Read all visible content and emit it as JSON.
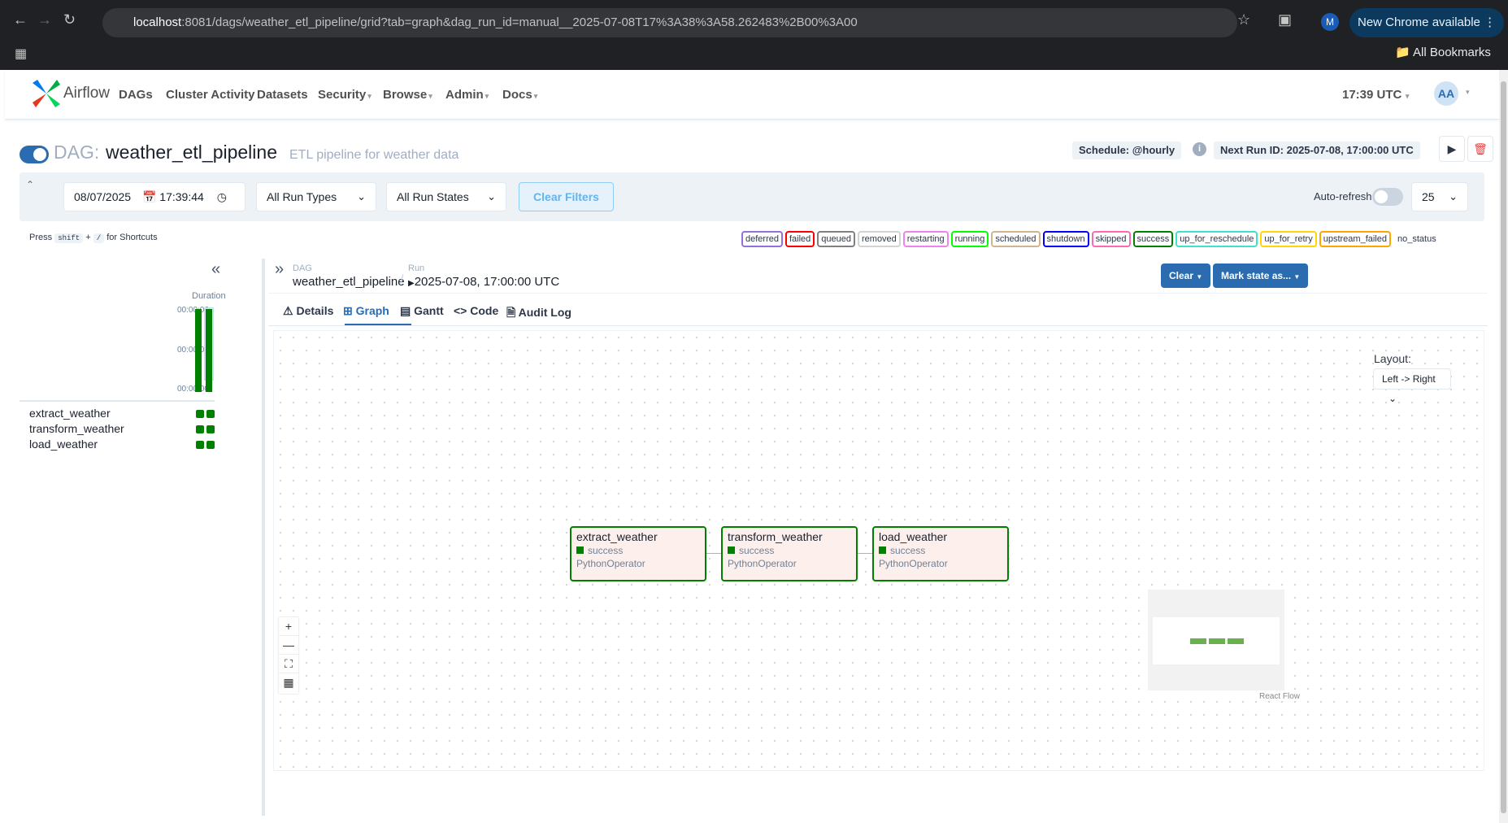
{
  "browser": {
    "url_host": "localhost",
    "url_rest": ":8081/dags/weather_etl_pipeline/grid?tab=graph&dag_run_id=manual__2025-07-08T17%3A38%3A58.262483%2B00%3A00",
    "new_chrome": "New Chrome available",
    "profile_initial": "M",
    "bookmarks": "All Bookmarks"
  },
  "navbar": {
    "brand": "Airflow",
    "links": [
      "DAGs",
      "Cluster Activity",
      "Datasets",
      "Security",
      "Browse",
      "Admin",
      "Docs"
    ],
    "time": "17:39 UTC",
    "user_initials": "AA"
  },
  "dag": {
    "prefix": "DAG:",
    "id": "weather_etl_pipeline",
    "description": "ETL pipeline for weather data",
    "schedule": "Schedule: @hourly",
    "next_run": "Next Run ID: 2025-07-08, 17:00:00 UTC",
    "paused": false
  },
  "filters": {
    "date": "08/07/2025",
    "time": "17:39:44",
    "run_types": "All Run Types",
    "run_states": "All Run States",
    "clear": "Clear Filters",
    "auto_refresh": "Auto-refresh",
    "auto_refresh_on": false,
    "page_size": "25"
  },
  "shortcuts": {
    "press": "Press",
    "key1": "shift",
    "plus": "+",
    "key2": "/",
    "suffix": "for Shortcuts"
  },
  "legend": [
    {
      "label": "deferred",
      "color": "#9370db"
    },
    {
      "label": "failed",
      "color": "#ff0000"
    },
    {
      "label": "queued",
      "color": "#808080"
    },
    {
      "label": "removed",
      "color": "#d3d3d3"
    },
    {
      "label": "restarting",
      "color": "#ee82ee"
    },
    {
      "label": "running",
      "color": "#00ff00"
    },
    {
      "label": "scheduled",
      "color": "#d2b48c"
    },
    {
      "label": "shutdown",
      "color": "#0000ff"
    },
    {
      "label": "skipped",
      "color": "#ff69b4"
    },
    {
      "label": "success",
      "color": "#008000"
    },
    {
      "label": "up_for_reschedule",
      "color": "#40e0d0"
    },
    {
      "label": "up_for_retry",
      "color": "#ffd700"
    },
    {
      "label": "upstream_failed",
      "color": "#ffa500"
    },
    {
      "label": "no_status",
      "color": "#ffffff"
    }
  ],
  "grid": {
    "duration_label": "Duration",
    "ticks": [
      "00:00:06",
      "00:00:03",
      "00:00:00"
    ],
    "tasks": [
      "extract_weather",
      "transform_weather",
      "load_weather"
    ]
  },
  "breadcrumb": {
    "dag_label": "DAG",
    "dag": "weather_etl_pipeline",
    "run_label": "Run",
    "run": "2025-07-08, 17:00:00 UTC"
  },
  "actions": {
    "clear": "Clear",
    "mark": "Mark state as..."
  },
  "tabs": [
    "Details",
    "Graph",
    "Gantt",
    "Code",
    "Audit Log"
  ],
  "graph": {
    "layout_label": "Layout:",
    "layout_value": "Left -> Right",
    "nodes": [
      {
        "name": "extract_weather",
        "state": "success",
        "operator": "PythonOperator"
      },
      {
        "name": "transform_weather",
        "state": "success",
        "operator": "PythonOperator"
      },
      {
        "name": "load_weather",
        "state": "success",
        "operator": "PythonOperator"
      }
    ],
    "attribution": "React Flow"
  }
}
